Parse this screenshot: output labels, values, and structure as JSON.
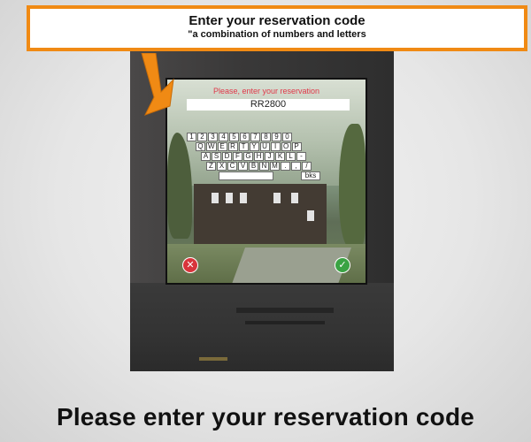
{
  "banner": {
    "title": "Enter your reservation code",
    "subtitle": "\"a combination of numbers and letters"
  },
  "kiosk": {
    "prompt": "Please, enter your reservation",
    "code_value": "RR2800",
    "keyboard": {
      "row1": [
        "1",
        "2",
        "3",
        "4",
        "5",
        "6",
        "7",
        "8",
        "9",
        "0"
      ],
      "row2": [
        "Q",
        "W",
        "E",
        "R",
        "T",
        "Y",
        "U",
        "I",
        "O",
        "P"
      ],
      "row3": [
        "A",
        "S",
        "D",
        "F",
        "G",
        "H",
        "J",
        "K",
        "L",
        "-"
      ],
      "row4": [
        "Z",
        "X",
        "C",
        "V",
        "B",
        "N",
        "M",
        ".",
        ",",
        "/"
      ],
      "backspace_label": "bks"
    },
    "cancel_icon": "x-icon",
    "confirm_icon": "check-icon"
  },
  "footer_title": "Please enter your reservation code",
  "colors": {
    "banner_border": "#f08a14",
    "arrow": "#f08a14",
    "prompt_text": "#e0394a",
    "cancel": "#d8343b",
    "confirm": "#3aa343"
  }
}
